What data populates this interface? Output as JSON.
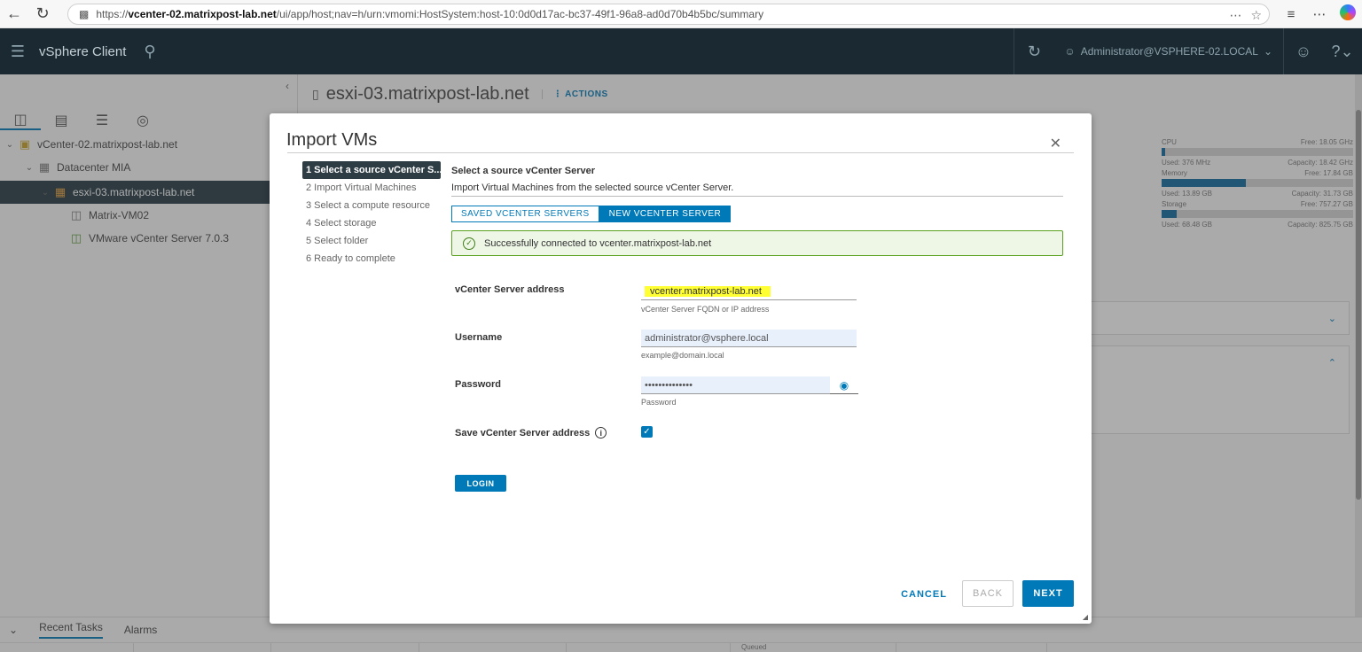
{
  "browser": {
    "url_prefix": "https://",
    "url_host": "vcenter-02.matrixpost-lab.net",
    "url_path": "/ui/app/host;nav=h/urn:vmomi:HostSystem:host-10:0d0d17ac-bc37-49f1-96a8-ad0d70b4b5bc/summary"
  },
  "header": {
    "app_title": "vSphere Client",
    "user": "Administrator@VSPHERE-02.LOCAL"
  },
  "tree": {
    "items": [
      {
        "label": "vCenter-02.matrixpost-lab.net"
      },
      {
        "label": "Datacenter MIA"
      },
      {
        "label": "esxi-03.matrixpost-lab.net"
      },
      {
        "label": "Matrix-VM02"
      },
      {
        "label": "VMware vCenter Server 7.0.3"
      }
    ]
  },
  "content": {
    "host_title": "esxi-03.matrixpost-lab.net",
    "actions_label": "ACTIONS"
  },
  "resources": {
    "cpu": {
      "label": "CPU",
      "free": "Free: 18.05 GHz",
      "used": "Used: 376 MHz",
      "capacity": "Capacity: 18.42 GHz",
      "fraction": 0.02
    },
    "memory": {
      "label": "Memory",
      "free": "Free: 17.84 GB",
      "used": "Used: 13.89 GB",
      "capacity": "Capacity: 31.73 GB",
      "fraction": 0.44
    },
    "storage": {
      "label": "Storage",
      "free": "Free: 757.27 GB",
      "used": "Used: 68.48 GB",
      "capacity": "Capacity: 825.75 GB",
      "fraction": 0.08
    }
  },
  "bottom": {
    "tabs": [
      "Recent Tasks",
      "Alarms"
    ],
    "column_fragment": "Queued"
  },
  "modal": {
    "title": "Import VMs",
    "steps": [
      "1 Select a source vCenter S...",
      "2 Import Virtual Machines",
      "3 Select a compute resource",
      "4 Select storage",
      "5 Select folder",
      "6 Ready to complete"
    ],
    "panel_heading": "Select a source vCenter Server",
    "panel_sub": "Import Virtual Machines from the selected source vCenter Server.",
    "seg_saved": "SAVED VCENTER SERVERS",
    "seg_new": "NEW VCENTER SERVER",
    "alert": "Successfully connected to vcenter.matrixpost-lab.net",
    "address_label": "vCenter Server address",
    "address_value": "vcenter.matrixpost-lab.net",
    "address_hint": "vCenter Server FQDN or IP address",
    "username_label": "Username",
    "username_value": "administrator@vsphere.local",
    "username_hint": "example@domain.local",
    "password_label": "Password",
    "password_value": "••••••••••••••",
    "password_hint": "Password",
    "save_label": "Save vCenter Server address",
    "save_checked": true,
    "login_label": "LOGIN",
    "cancel_label": "CANCEL",
    "back_label": "BACK",
    "next_label": "NEXT"
  },
  "colors": {
    "accent": "#0079b8",
    "header_bg": "#1b2a32",
    "success_border": "#5aa220",
    "highlight": "#ffff33"
  }
}
